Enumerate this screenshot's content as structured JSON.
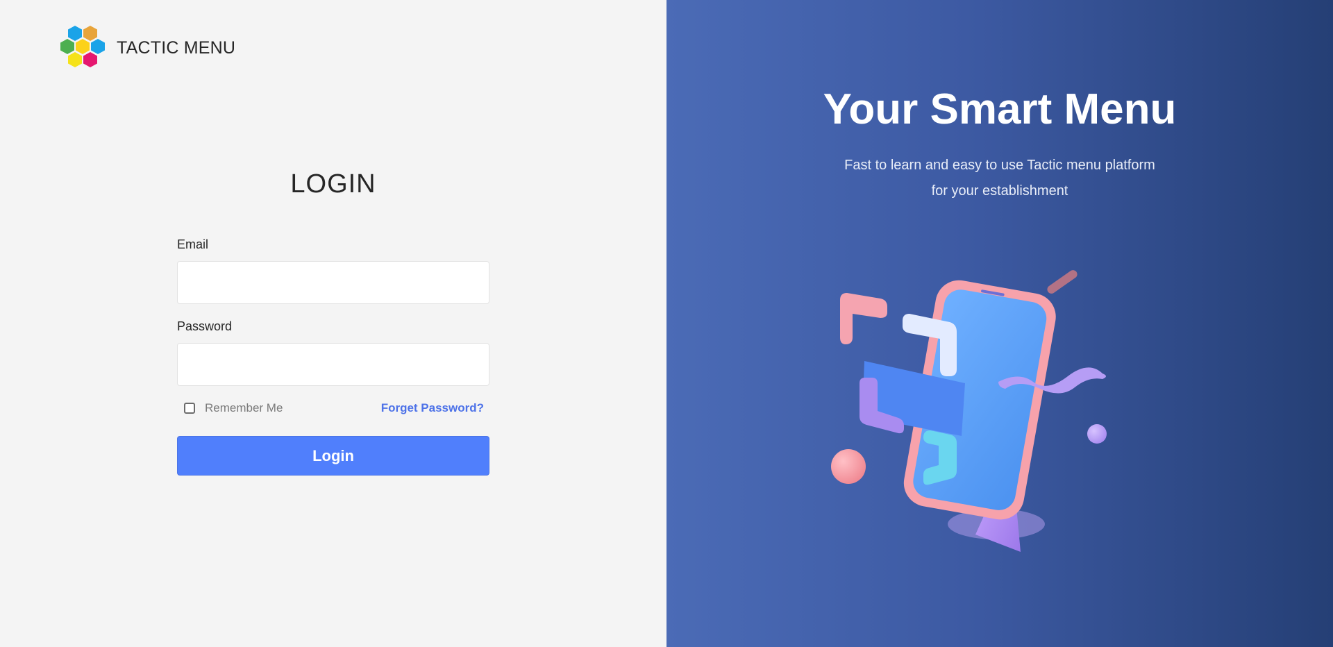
{
  "brand": {
    "name": "TACTIC MENU",
    "logo_icon": "hexagon-cluster-logo",
    "logo_colors": [
      "#1aa3e8",
      "#e8a43a",
      "#4caf50",
      "#f5e21a",
      "#1aa3e8",
      "#fcd21a",
      "#e5176f"
    ]
  },
  "login": {
    "title": "LOGIN",
    "email_label": "Email",
    "email_value": "",
    "email_placeholder": "",
    "password_label": "Password",
    "password_value": "",
    "password_placeholder": "",
    "remember_label": "Remember Me",
    "remember_checked": false,
    "forget_label": "Forget Password?",
    "submit_label": "Login"
  },
  "hero": {
    "title": "Your Smart Menu",
    "subtitle_line1": "Fast to learn and easy to use Tactic menu platform",
    "subtitle_line2": "for your establishment",
    "illustration_icon": "smartphone-3d-illustration"
  },
  "colors": {
    "left_bg": "#f4f4f4",
    "primary": "#507ffc",
    "link": "#4d72e8",
    "right_bg_start": "#4b6bb6",
    "right_bg_end": "#253f75"
  }
}
